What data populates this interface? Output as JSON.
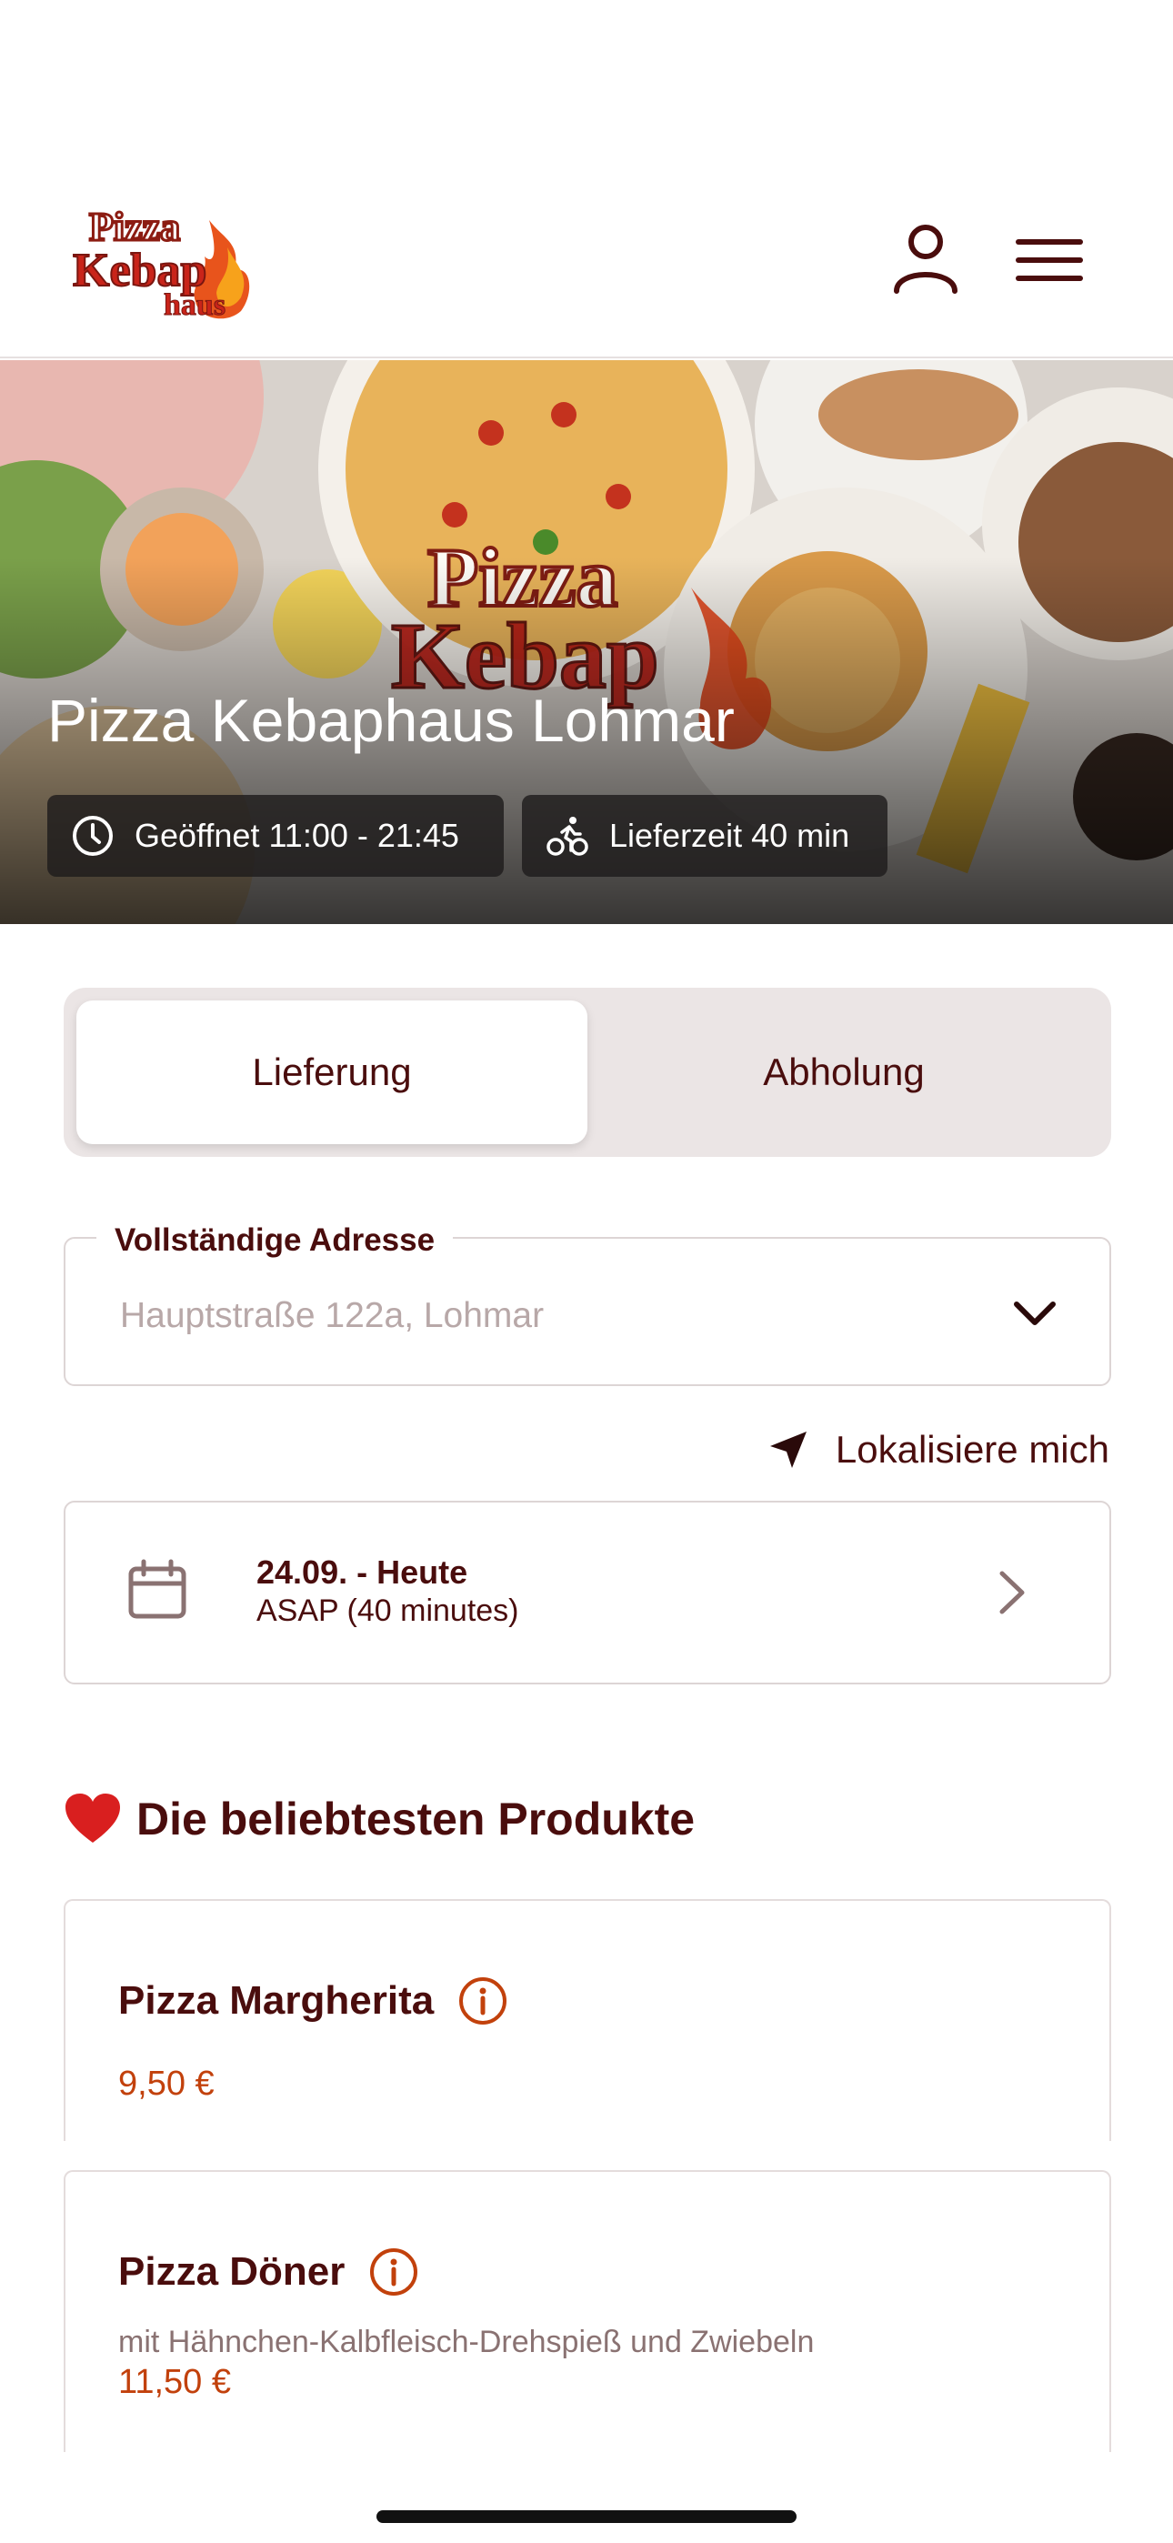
{
  "header": {
    "logo_text_top": "Pizza",
    "logo_text_bottom": "Kebap",
    "logo_text_sub": "haus",
    "account_icon": "user-icon",
    "menu_icon": "hamburger-menu-icon"
  },
  "hero": {
    "title": "Pizza Kebaphaus Lohmar",
    "opening": "Geöffnet 11:00 - 21:45",
    "delivery_time": "Lieferzeit 40 min",
    "opening_icon": "clock-icon",
    "delivery_icon": "bicycle-icon"
  },
  "order_mode": {
    "options": [
      "Lieferung",
      "Abholung"
    ],
    "selected": "Lieferung"
  },
  "address": {
    "label": "Vollständige Adresse",
    "placeholder": "Hauptstraße 122a, Lohmar"
  },
  "locate": {
    "label": "Lokalisiere mich",
    "icon": "location-arrow-icon"
  },
  "schedule": {
    "date": "24.09. - Heute",
    "time": "ASAP (40 minutes)",
    "icon": "calendar-icon"
  },
  "popular": {
    "title": "Die beliebtesten Produkte",
    "icon": "heart-icon",
    "products": [
      {
        "name": "Pizza Margherita",
        "description": "",
        "price": "9,50 €"
      },
      {
        "name": "Pizza Döner",
        "description": "mit Hähnchen-Kalbfleisch-Drehspieß und Zwiebeln",
        "price": "11,50 €"
      }
    ]
  },
  "colors": {
    "brand_text": "#4a0d0d",
    "price": "#c2410c",
    "segment_bg": "#ebe5e5"
  }
}
